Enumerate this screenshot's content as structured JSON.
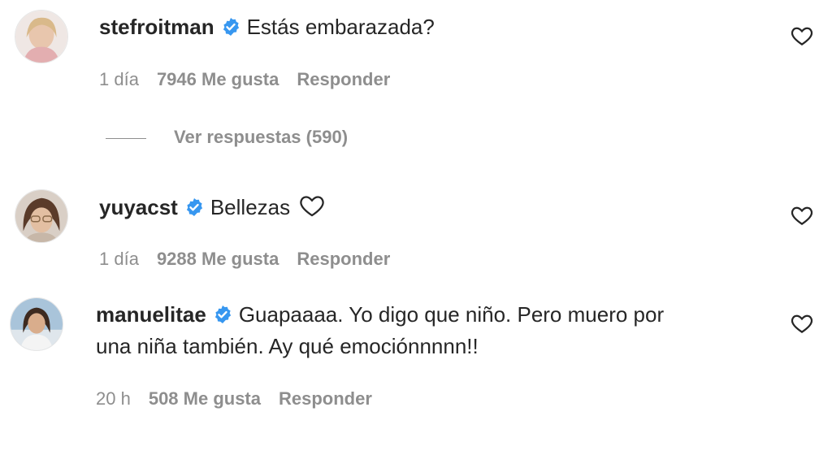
{
  "colors": {
    "verified": "#3797f0",
    "muted": "#8e8e8e",
    "text": "#262626"
  },
  "comments": [
    {
      "username": "stefroitman",
      "text": "Estás embarazada?",
      "time": "1 día",
      "likes": "7946 Me gusta",
      "reply": "Responder",
      "view_replies": "Ver respuestas (590)"
    },
    {
      "username": "yuyacst",
      "text": "Bellezas",
      "text_icon": "heart-icon",
      "time": "1 día",
      "likes": "9288 Me gusta",
      "reply": "Responder"
    },
    {
      "username": "manuelitae",
      "text": "Guapaaaa. Yo digo que niño. Pero muero por",
      "text2": "una niña también. Ay qué emociónnnnn!!",
      "time": "20 h",
      "likes": "508 Me gusta",
      "reply": "Responder"
    }
  ]
}
